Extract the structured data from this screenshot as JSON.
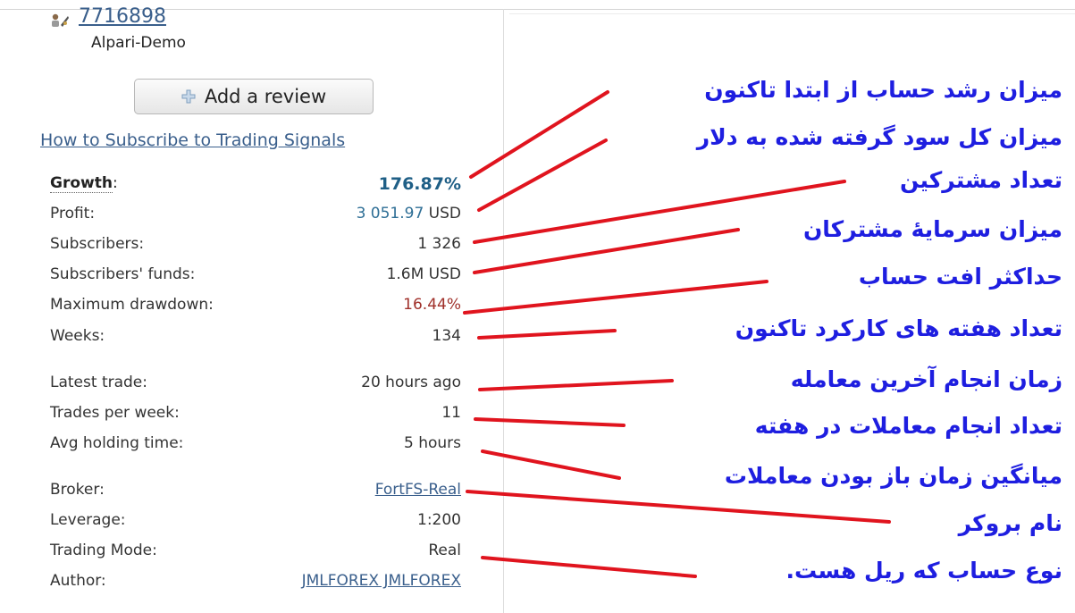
{
  "account": {
    "id": "7716898",
    "server": "Alpari-Demo"
  },
  "review_button": {
    "label": "Add a review",
    "icon": "plus-icon"
  },
  "subscribe_link": "How to Subscribe to Trading Signals",
  "stats": {
    "growth": {
      "label": "Growth",
      "colon": ":",
      "value": "176.87%"
    },
    "profit": {
      "label": "Profit:",
      "amount": "3 051.97",
      "unit": " USD"
    },
    "subscribers": {
      "label": "Subscribers:",
      "value": "1 326"
    },
    "subscribers_funds": {
      "label": "Subscribers' funds:",
      "value": "1.6M USD"
    },
    "max_drawdown": {
      "label": "Maximum drawdown:",
      "value": "16.44%"
    },
    "weeks": {
      "label": "Weeks:",
      "value": "134"
    },
    "latest_trade": {
      "label": "Latest trade:",
      "value": "20 hours ago"
    },
    "trades_per_week": {
      "label": "Trades per week:",
      "value": "11"
    },
    "avg_holding": {
      "label": "Avg holding time:",
      "value": "5 hours"
    },
    "broker": {
      "label": "Broker:",
      "value": "FortFS-Real"
    },
    "leverage": {
      "label": "Leverage:",
      "value": "1:200"
    },
    "trading_mode": {
      "label": "Trading Mode:",
      "value": "Real"
    },
    "author": {
      "label": "Author:",
      "value": "JMLFOREX JMLFOREX"
    }
  },
  "annotations": {
    "growth": "میزان رشد حساب از ابتدا تاکنون",
    "profit": "میزان کل سود گرفته شده به دلار",
    "subscribers": "تعداد مشترکین",
    "funds": "میزان سرمایهٔ مشترکان",
    "drawdown": "حداکثر افت حساب",
    "weeks": "تعداد هفته های کارکرد تاکنون",
    "latest": "زمان انجام آخرین معامله",
    "trades_week": "تعداد انجام معاملات در هفته",
    "holding": "میانگین زمان باز بودن معاملات",
    "broker": "نام بروکر",
    "mode": "نوع حساب که ریل هست."
  },
  "colors": {
    "annotation_text": "#1e1ee0",
    "arrow_line": "#e0141e",
    "link": "#3a5f8c",
    "growth": "#1f5f86",
    "drawdown": "#a0302a"
  }
}
